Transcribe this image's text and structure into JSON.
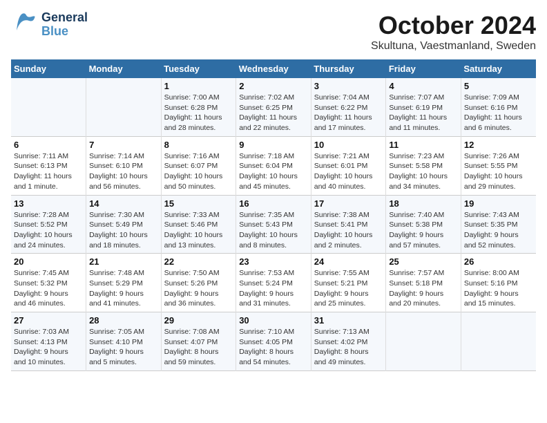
{
  "header": {
    "logo": {
      "general": "General",
      "blue": "Blue"
    },
    "title": "October 2024",
    "subtitle": "Skultuna, Vaestmanland, Sweden"
  },
  "days_of_week": [
    "Sunday",
    "Monday",
    "Tuesday",
    "Wednesday",
    "Thursday",
    "Friday",
    "Saturday"
  ],
  "weeks": [
    [
      {
        "day": "",
        "info": ""
      },
      {
        "day": "",
        "info": ""
      },
      {
        "day": "1",
        "info": "Sunrise: 7:00 AM\nSunset: 6:28 PM\nDaylight: 11 hours\nand 28 minutes."
      },
      {
        "day": "2",
        "info": "Sunrise: 7:02 AM\nSunset: 6:25 PM\nDaylight: 11 hours\nand 22 minutes."
      },
      {
        "day": "3",
        "info": "Sunrise: 7:04 AM\nSunset: 6:22 PM\nDaylight: 11 hours\nand 17 minutes."
      },
      {
        "day": "4",
        "info": "Sunrise: 7:07 AM\nSunset: 6:19 PM\nDaylight: 11 hours\nand 11 minutes."
      },
      {
        "day": "5",
        "info": "Sunrise: 7:09 AM\nSunset: 6:16 PM\nDaylight: 11 hours\nand 6 minutes."
      }
    ],
    [
      {
        "day": "6",
        "info": "Sunrise: 7:11 AM\nSunset: 6:13 PM\nDaylight: 11 hours\nand 1 minute."
      },
      {
        "day": "7",
        "info": "Sunrise: 7:14 AM\nSunset: 6:10 PM\nDaylight: 10 hours\nand 56 minutes."
      },
      {
        "day": "8",
        "info": "Sunrise: 7:16 AM\nSunset: 6:07 PM\nDaylight: 10 hours\nand 50 minutes."
      },
      {
        "day": "9",
        "info": "Sunrise: 7:18 AM\nSunset: 6:04 PM\nDaylight: 10 hours\nand 45 minutes."
      },
      {
        "day": "10",
        "info": "Sunrise: 7:21 AM\nSunset: 6:01 PM\nDaylight: 10 hours\nand 40 minutes."
      },
      {
        "day": "11",
        "info": "Sunrise: 7:23 AM\nSunset: 5:58 PM\nDaylight: 10 hours\nand 34 minutes."
      },
      {
        "day": "12",
        "info": "Sunrise: 7:26 AM\nSunset: 5:55 PM\nDaylight: 10 hours\nand 29 minutes."
      }
    ],
    [
      {
        "day": "13",
        "info": "Sunrise: 7:28 AM\nSunset: 5:52 PM\nDaylight: 10 hours\nand 24 minutes."
      },
      {
        "day": "14",
        "info": "Sunrise: 7:30 AM\nSunset: 5:49 PM\nDaylight: 10 hours\nand 18 minutes."
      },
      {
        "day": "15",
        "info": "Sunrise: 7:33 AM\nSunset: 5:46 PM\nDaylight: 10 hours\nand 13 minutes."
      },
      {
        "day": "16",
        "info": "Sunrise: 7:35 AM\nSunset: 5:43 PM\nDaylight: 10 hours\nand 8 minutes."
      },
      {
        "day": "17",
        "info": "Sunrise: 7:38 AM\nSunset: 5:41 PM\nDaylight: 10 hours\nand 2 minutes."
      },
      {
        "day": "18",
        "info": "Sunrise: 7:40 AM\nSunset: 5:38 PM\nDaylight: 9 hours\nand 57 minutes."
      },
      {
        "day": "19",
        "info": "Sunrise: 7:43 AM\nSunset: 5:35 PM\nDaylight: 9 hours\nand 52 minutes."
      }
    ],
    [
      {
        "day": "20",
        "info": "Sunrise: 7:45 AM\nSunset: 5:32 PM\nDaylight: 9 hours\nand 46 minutes."
      },
      {
        "day": "21",
        "info": "Sunrise: 7:48 AM\nSunset: 5:29 PM\nDaylight: 9 hours\nand 41 minutes."
      },
      {
        "day": "22",
        "info": "Sunrise: 7:50 AM\nSunset: 5:26 PM\nDaylight: 9 hours\nand 36 minutes."
      },
      {
        "day": "23",
        "info": "Sunrise: 7:53 AM\nSunset: 5:24 PM\nDaylight: 9 hours\nand 31 minutes."
      },
      {
        "day": "24",
        "info": "Sunrise: 7:55 AM\nSunset: 5:21 PM\nDaylight: 9 hours\nand 25 minutes."
      },
      {
        "day": "25",
        "info": "Sunrise: 7:57 AM\nSunset: 5:18 PM\nDaylight: 9 hours\nand 20 minutes."
      },
      {
        "day": "26",
        "info": "Sunrise: 8:00 AM\nSunset: 5:16 PM\nDaylight: 9 hours\nand 15 minutes."
      }
    ],
    [
      {
        "day": "27",
        "info": "Sunrise: 7:03 AM\nSunset: 4:13 PM\nDaylight: 9 hours\nand 10 minutes."
      },
      {
        "day": "28",
        "info": "Sunrise: 7:05 AM\nSunset: 4:10 PM\nDaylight: 9 hours\nand 5 minutes."
      },
      {
        "day": "29",
        "info": "Sunrise: 7:08 AM\nSunset: 4:07 PM\nDaylight: 8 hours\nand 59 minutes."
      },
      {
        "day": "30",
        "info": "Sunrise: 7:10 AM\nSunset: 4:05 PM\nDaylight: 8 hours\nand 54 minutes."
      },
      {
        "day": "31",
        "info": "Sunrise: 7:13 AM\nSunset: 4:02 PM\nDaylight: 8 hours\nand 49 minutes."
      },
      {
        "day": "",
        "info": ""
      },
      {
        "day": "",
        "info": ""
      }
    ]
  ]
}
